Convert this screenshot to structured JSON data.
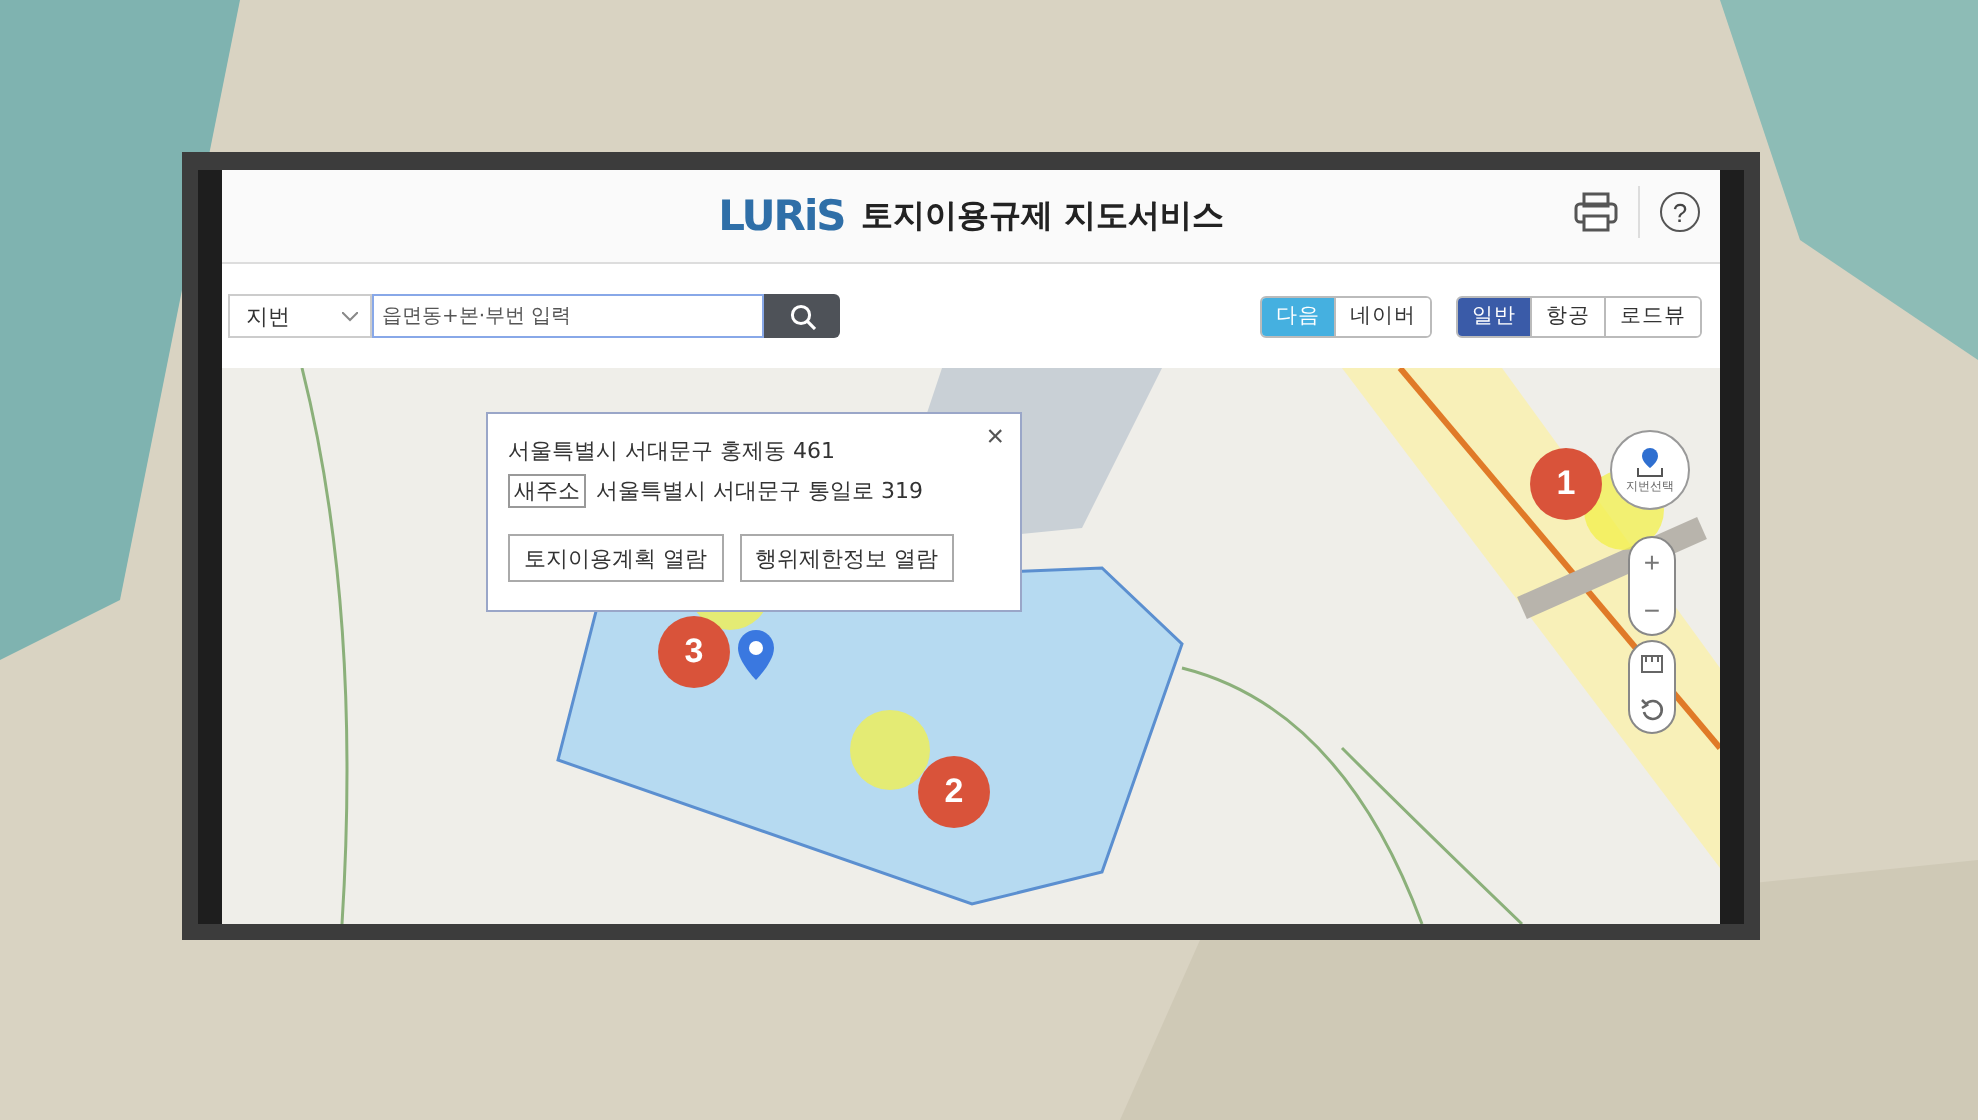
{
  "header": {
    "logo": "LURiS",
    "title": "토지이용규제 지도서비스",
    "help": "?"
  },
  "search": {
    "type": "지번",
    "placeholder": "읍면동+본·부번 입력"
  },
  "map_providers": [
    {
      "label": "다음",
      "selected": true
    },
    {
      "label": "네이버",
      "selected": false
    }
  ],
  "map_types": [
    {
      "label": "일반",
      "selected": true
    },
    {
      "label": "항공",
      "selected": false
    },
    {
      "label": "로드뷰",
      "selected": false
    }
  ],
  "popup": {
    "address": "서울특별시 서대문구 홍제동 461",
    "road_badge": "새주소",
    "road_address": "서울특별시 서대문구 통일로 319",
    "close": "×",
    "buttons": [
      "토지이용계획 열람",
      "행위제한정보 열람"
    ]
  },
  "map_controls": {
    "select_label": "지번선택",
    "zoom_in": "+",
    "zoom_out": "−"
  },
  "step_markers": [
    "1",
    "2",
    "3"
  ]
}
